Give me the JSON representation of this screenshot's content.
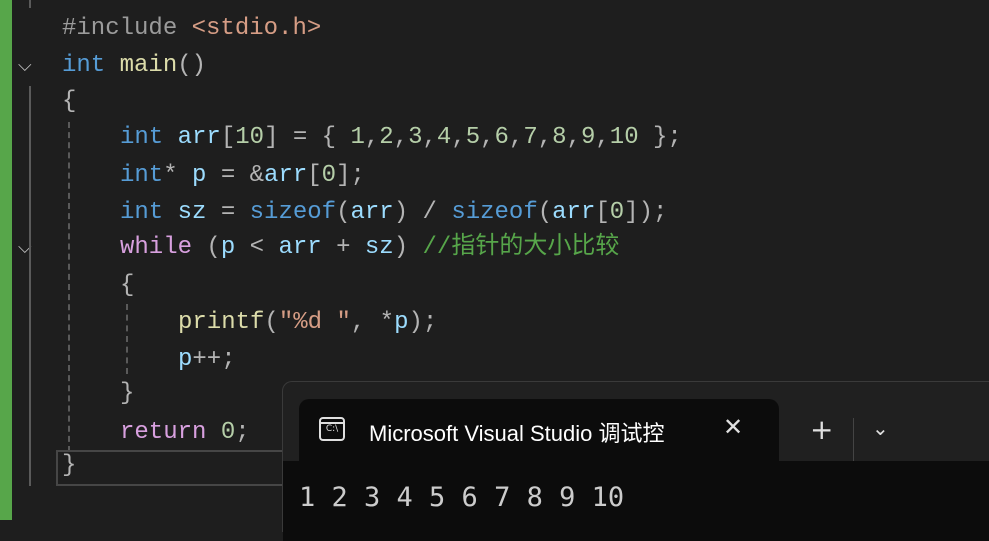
{
  "editor": {
    "lines": [
      {
        "indent": 0,
        "tokens": [
          [
            "#include ",
            "pp"
          ],
          [
            "<stdio.h>",
            "str"
          ]
        ]
      },
      {
        "indent": 0,
        "tokens": [
          [
            "int",
            "kw"
          ],
          [
            " ",
            "pn"
          ],
          [
            "main",
            "fn"
          ],
          [
            "()",
            "pn"
          ]
        ]
      },
      {
        "indent": 0,
        "tokens": [
          [
            "{",
            "pn"
          ]
        ]
      },
      {
        "indent": 4,
        "tokens": [
          [
            "int",
            "kw"
          ],
          [
            " ",
            "pn"
          ],
          [
            "arr",
            "var"
          ],
          [
            "[",
            "pn"
          ],
          [
            "10",
            "num"
          ],
          [
            "] = { ",
            "pn"
          ],
          [
            "1",
            "num"
          ],
          [
            ",",
            "pn"
          ],
          [
            "2",
            "num"
          ],
          [
            ",",
            "pn"
          ],
          [
            "3",
            "num"
          ],
          [
            ",",
            "pn"
          ],
          [
            "4",
            "num"
          ],
          [
            ",",
            "pn"
          ],
          [
            "5",
            "num"
          ],
          [
            ",",
            "pn"
          ],
          [
            "6",
            "num"
          ],
          [
            ",",
            "pn"
          ],
          [
            "7",
            "num"
          ],
          [
            ",",
            "pn"
          ],
          [
            "8",
            "num"
          ],
          [
            ",",
            "pn"
          ],
          [
            "9",
            "num"
          ],
          [
            ",",
            "pn"
          ],
          [
            "10",
            "num"
          ],
          [
            " };",
            "pn"
          ]
        ]
      },
      {
        "indent": 4,
        "tokens": [
          [
            "int",
            "kw"
          ],
          [
            "* ",
            "pn"
          ],
          [
            "p",
            "var"
          ],
          [
            " = &",
            "pn"
          ],
          [
            "arr",
            "var"
          ],
          [
            "[",
            "pn"
          ],
          [
            "0",
            "num"
          ],
          [
            "];",
            "pn"
          ]
        ]
      },
      {
        "indent": 4,
        "tokens": [
          [
            "int",
            "kw"
          ],
          [
            " ",
            "pn"
          ],
          [
            "sz",
            "var"
          ],
          [
            " = ",
            "pn"
          ],
          [
            "sizeof",
            "kw"
          ],
          [
            "(",
            "pn"
          ],
          [
            "arr",
            "var"
          ],
          [
            ") / ",
            "pn"
          ],
          [
            "sizeof",
            "kw"
          ],
          [
            "(",
            "pn"
          ],
          [
            "arr",
            "var"
          ],
          [
            "[",
            "pn"
          ],
          [
            "0",
            "num"
          ],
          [
            "]);",
            "pn"
          ]
        ]
      },
      {
        "indent": 4,
        "tokens": [
          [
            "while",
            "ctl"
          ],
          [
            " (",
            "pn"
          ],
          [
            "p",
            "var"
          ],
          [
            " < ",
            "pn"
          ],
          [
            "arr",
            "var"
          ],
          [
            " + ",
            "pn"
          ],
          [
            "sz",
            "var"
          ],
          [
            ") ",
            "pn"
          ],
          [
            "//指针的大小比较",
            "cm"
          ]
        ]
      },
      {
        "indent": 4,
        "tokens": [
          [
            "{",
            "pn"
          ]
        ]
      },
      {
        "indent": 8,
        "tokens": [
          [
            "printf",
            "fn"
          ],
          [
            "(",
            "pn"
          ],
          [
            "\"%d \"",
            "str"
          ],
          [
            ", *",
            "pn"
          ],
          [
            "p",
            "var"
          ],
          [
            ");",
            "pn"
          ]
        ]
      },
      {
        "indent": 8,
        "tokens": [
          [
            "p",
            "var"
          ],
          [
            "++;",
            "pn"
          ]
        ]
      },
      {
        "indent": 4,
        "tokens": [
          [
            "}",
            "pn"
          ]
        ]
      },
      {
        "indent": 4,
        "tokens": [
          [
            "return",
            "ctl"
          ],
          [
            " ",
            "pn"
          ],
          [
            "0",
            "num"
          ],
          [
            ";",
            "pn"
          ]
        ]
      },
      {
        "indent": 0,
        "tokens": [
          [
            "}",
            "pn"
          ]
        ]
      }
    ]
  },
  "terminal": {
    "icon": "console-icon",
    "icon_text": "C:\\",
    "tab_title": "Microsoft Visual Studio 调试控",
    "close": "✕",
    "new_tab": "+",
    "dropdown": "⌄",
    "output": "1 2 3 4 5 6 7 8 9 10"
  }
}
